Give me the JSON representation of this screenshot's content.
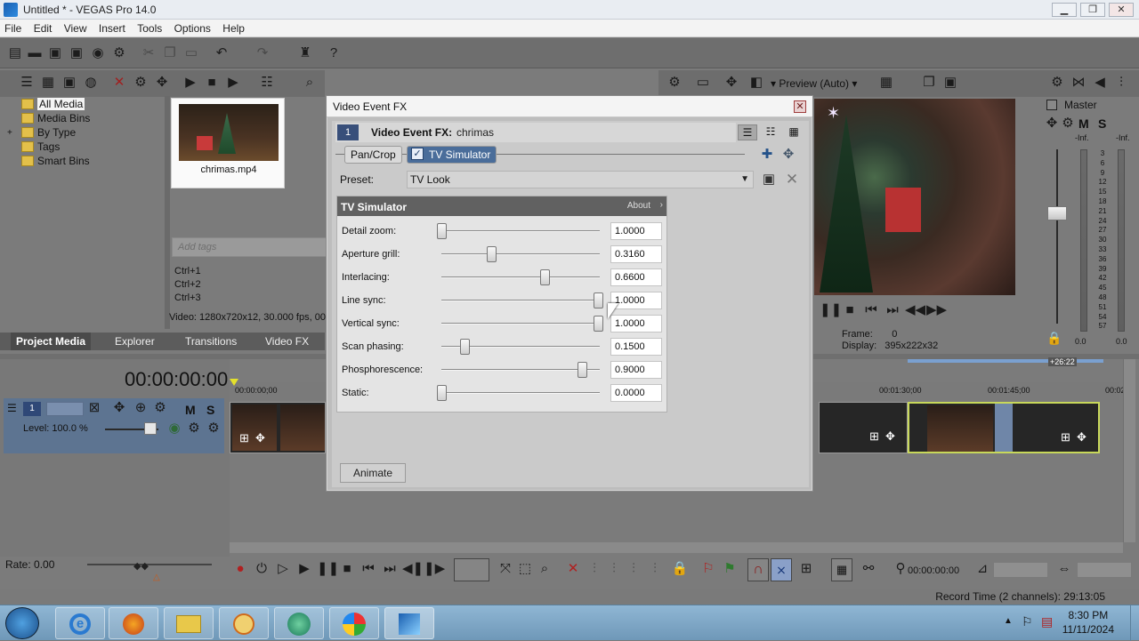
{
  "window": {
    "title": "Untitled * - VEGAS Pro 14.0"
  },
  "menu": [
    "File",
    "Edit",
    "View",
    "Insert",
    "Tools",
    "Options",
    "Help"
  ],
  "project_media": {
    "tree": [
      "All Media",
      "Media Bins",
      "By Type",
      "Tags",
      "Smart Bins"
    ],
    "media_file": "chrimas.mp4",
    "add_tags_placeholder": "Add tags",
    "shortcuts": [
      "Ctrl+1",
      "Ctrl+2",
      "Ctrl+3"
    ],
    "info": "Video: 1280x720x12, 30.000 fps, 00"
  },
  "left_tabs": [
    "Project Media",
    "Explorer",
    "Transitions",
    "Video FX"
  ],
  "preview": {
    "mode": "Preview (Auto)",
    "frame_label": "Frame:",
    "frame_value": "0",
    "display_label": "Display:",
    "display_value": "395x222x32"
  },
  "master": {
    "title": "Master",
    "left_inf": "-Inf.",
    "right_inf": "-Inf.",
    "scale": [
      "3",
      "6",
      "9",
      "12",
      "15",
      "18",
      "21",
      "24",
      "27",
      "30",
      "33",
      "36",
      "39",
      "42",
      "45",
      "48",
      "51",
      "54",
      "57"
    ],
    "left_level": "0.0",
    "right_level": "0.0"
  },
  "timeline": {
    "timecode": "00:00:00:00",
    "track_number": "1",
    "level": "Level: 100.0 %",
    "ruler": [
      "00:00:00;00",
      "00:01:30;00",
      "00:01:45;00",
      "00:02:"
    ],
    "region": "+26:22",
    "rate": "Rate: 0.00",
    "cursor_time": "00:00:00:00",
    "record_time": "Record Time (2 channels): 29:13:05"
  },
  "fx_dialog": {
    "title": "Video Event FX",
    "chain_index": "1",
    "header_label": "Video Event FX:",
    "event_name": "chrimas",
    "chain": [
      "Pan/Crop",
      "TV Simulator"
    ],
    "preset_label": "Preset:",
    "preset_value": "TV Look",
    "panel_title": "TV Simulator",
    "about": "About",
    "params": [
      {
        "label": "Detail zoom:",
        "value": "1.0000",
        "pos": 0.0
      },
      {
        "label": "Aperture grill:",
        "value": "0.3160",
        "pos": 0.316
      },
      {
        "label": "Interlacing:",
        "value": "0.6600",
        "pos": 0.66
      },
      {
        "label": "Line sync:",
        "value": "1.0000",
        "pos": 1.0
      },
      {
        "label": "Vertical sync:",
        "value": "1.0000",
        "pos": 1.0
      },
      {
        "label": "Scan phasing:",
        "value": "0.1500",
        "pos": 0.15
      },
      {
        "label": "Phosphorescence:",
        "value": "0.9000",
        "pos": 0.9
      },
      {
        "label": "Static:",
        "value": "0.0000",
        "pos": 0.0
      }
    ],
    "animate": "Animate"
  },
  "taskbar": {
    "time": "8:30 PM",
    "date": "11/11/2024"
  }
}
